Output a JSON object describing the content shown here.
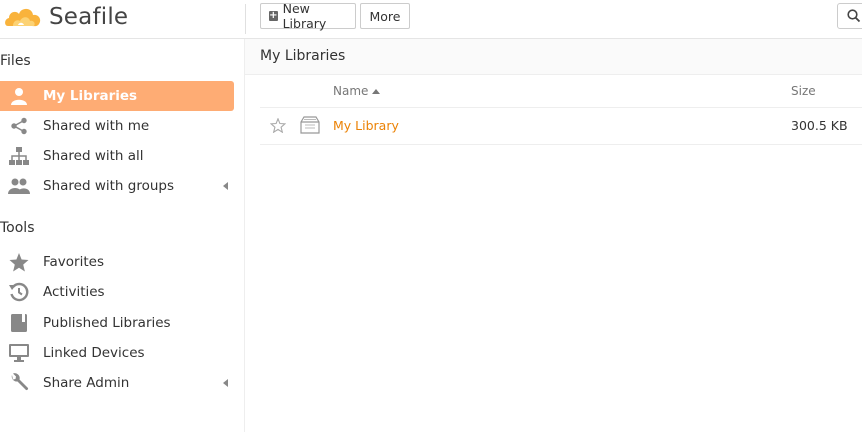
{
  "app": {
    "brand": "Seafile",
    "brand_color": "#f5a623"
  },
  "toolbar": {
    "new_library_label": "New Library",
    "more_label": "More",
    "search_icon": "search-icon"
  },
  "sidebar": {
    "files_heading": "Files",
    "files_items": [
      {
        "label": "My Libraries",
        "icon": "user-icon",
        "active": true
      },
      {
        "label": "Shared with me",
        "icon": "share-icon"
      },
      {
        "label": "Shared with all",
        "icon": "sitemap-icon"
      },
      {
        "label": "Shared with groups",
        "icon": "group-icon",
        "expandable": true
      }
    ],
    "tools_heading": "Tools",
    "tools_items": [
      {
        "label": "Favorites",
        "icon": "star-icon"
      },
      {
        "label": "Activities",
        "icon": "history-icon"
      },
      {
        "label": "Published Libraries",
        "icon": "book-icon"
      },
      {
        "label": "Linked Devices",
        "icon": "monitor-icon"
      },
      {
        "label": "Share Admin",
        "icon": "wrench-icon",
        "expandable": true
      }
    ],
    "active_color": "#feac74"
  },
  "main": {
    "title": "My Libraries",
    "columns": {
      "name": "Name",
      "size": "Size"
    },
    "rows": [
      {
        "name": "My Library",
        "size": "300.5 KB",
        "starred": false
      }
    ],
    "link_color": "#eb8205"
  }
}
